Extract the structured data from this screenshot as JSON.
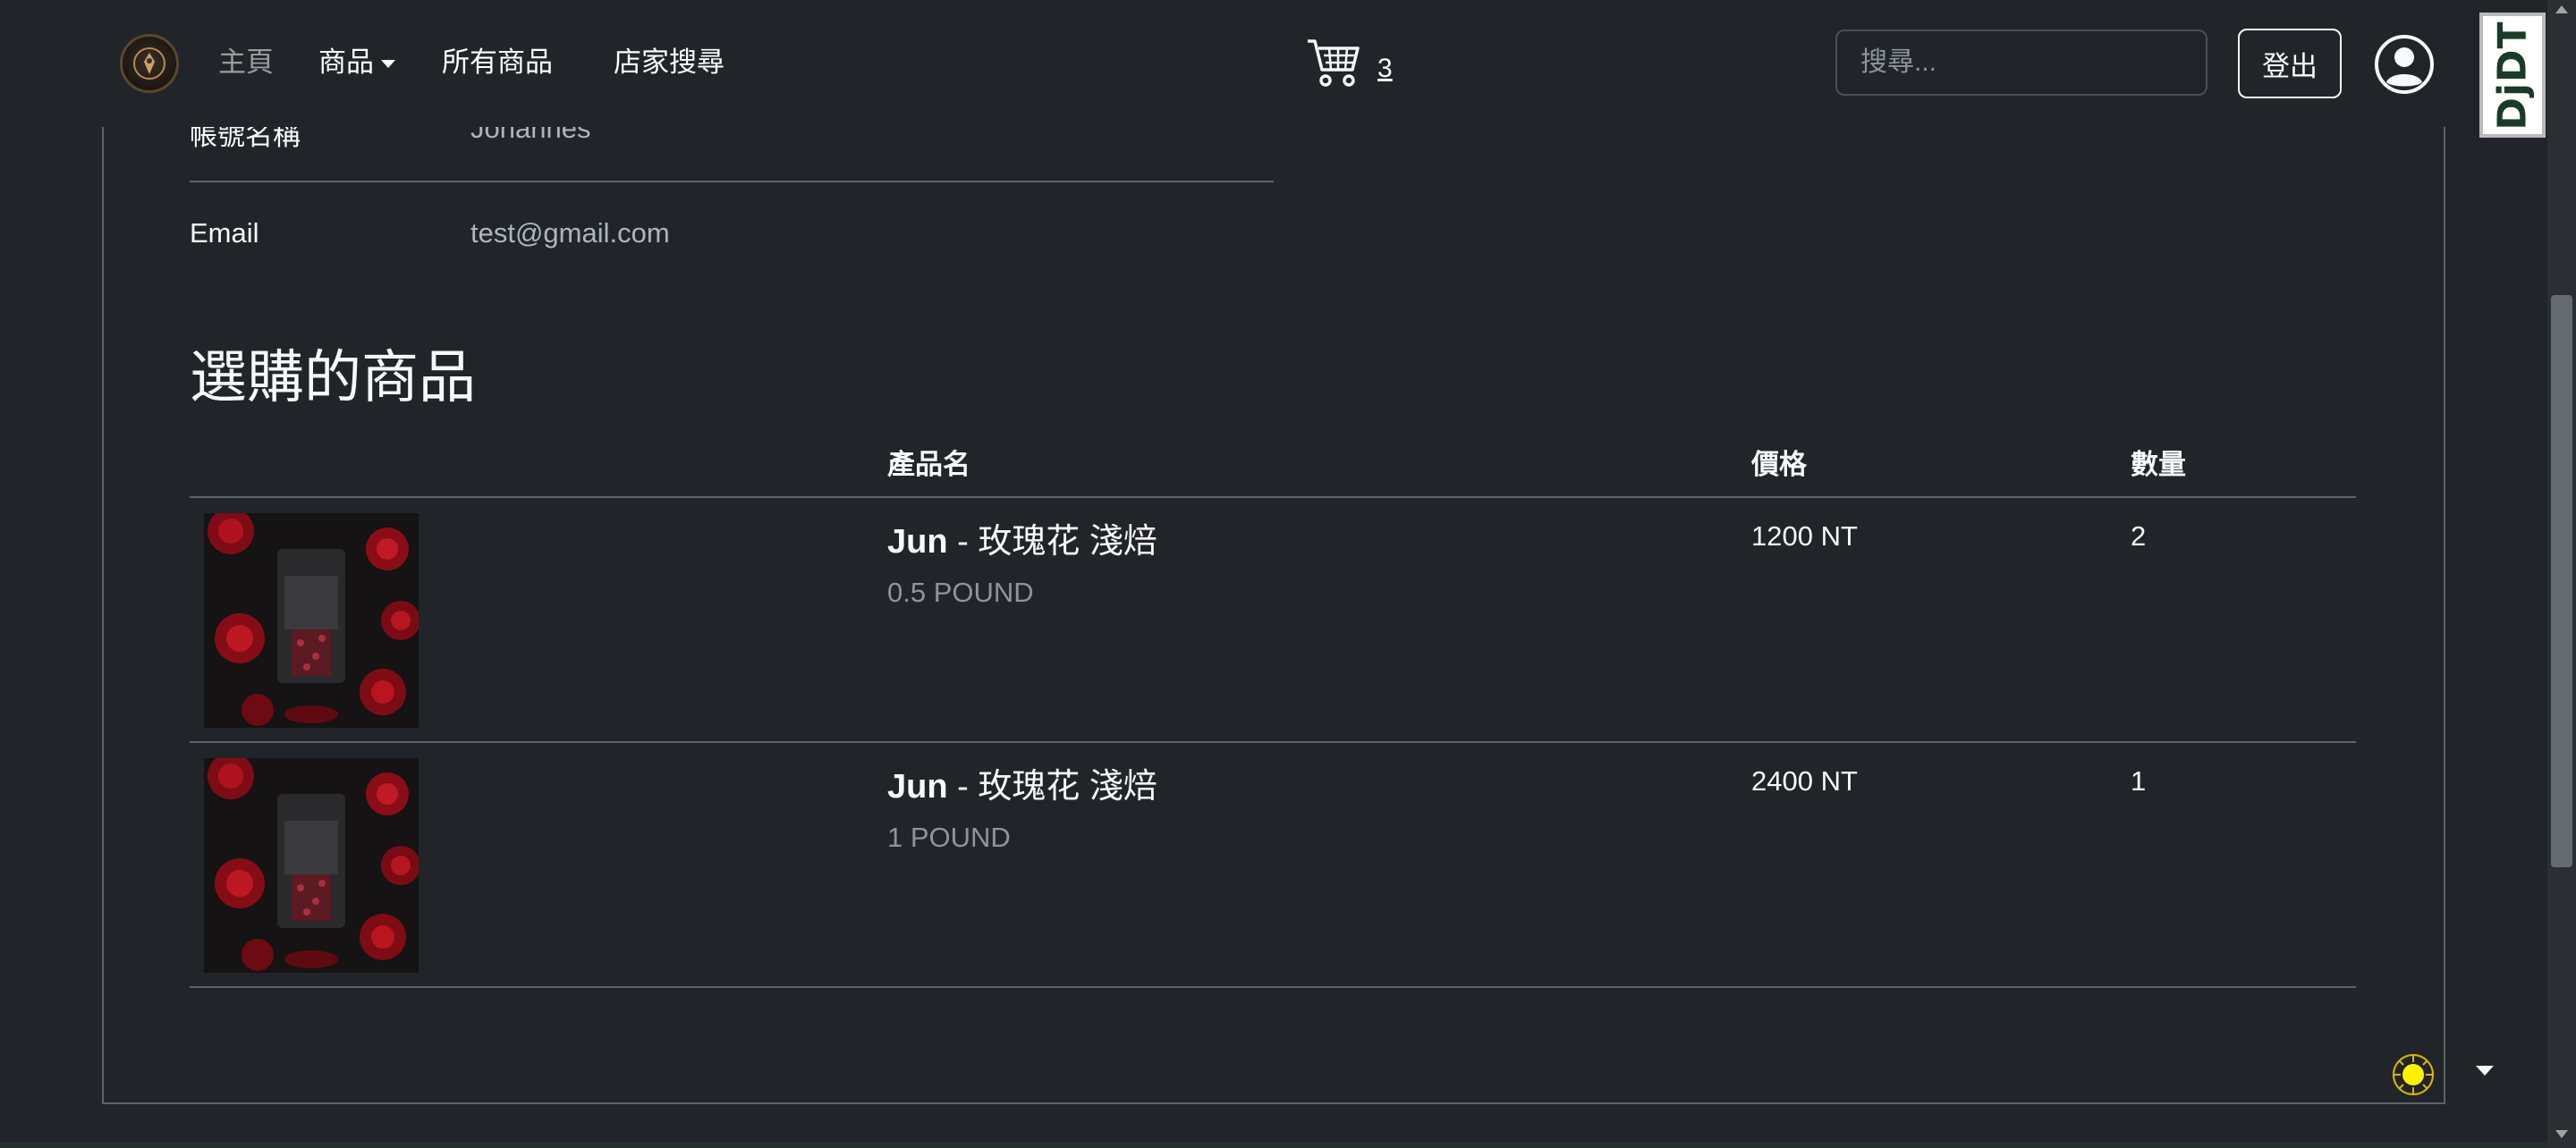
{
  "navbar": {
    "home": "主頁",
    "products": "商品",
    "all_products": "所有商品",
    "store_search": "店家搜尋",
    "cart_count": "3",
    "search_placeholder": "搜尋...",
    "logout": "登出"
  },
  "djdt": {
    "label": "DjDT"
  },
  "account": {
    "username_label": "帳號名稱",
    "username_value": "Johannes",
    "email_label": "Email",
    "email_value": "test@gmail.com"
  },
  "orders": {
    "title": "選購的商品",
    "columns": {
      "name": "產品名",
      "price": "價格",
      "qty": "數量"
    },
    "rows": [
      {
        "brand": "Jun",
        "name": " - 玫瑰花 淺焙",
        "size": "0.5 POUND",
        "price": "1200 NT",
        "qty": "2"
      },
      {
        "brand": "Jun",
        "name": " - 玫瑰花 淺焙",
        "size": "1 POUND",
        "price": "2400 NT",
        "qty": "1"
      }
    ]
  },
  "colors": {
    "background": "#212529",
    "border": "#5c636a",
    "muted_text": "#8d949b"
  },
  "icons": [
    "brand-logo-icon",
    "cart-icon",
    "account-circle-icon",
    "theme-toggle-sun-icon",
    "caret-down-icon"
  ]
}
